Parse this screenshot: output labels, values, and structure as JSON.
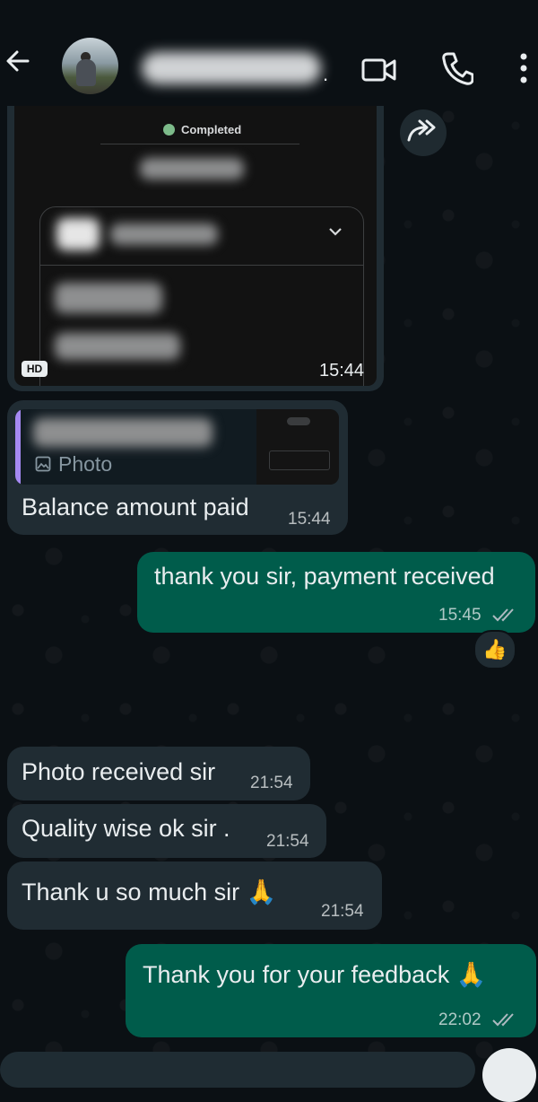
{
  "status_bar": {
    "left_text": "",
    "right_text": ""
  },
  "header": {
    "contact_name": "",
    "name_suffix": ".",
    "icons": [
      "back-arrow-icon",
      "video-call-icon",
      "voice-call-icon",
      "more-options-icon"
    ]
  },
  "avatar_caption": "",
  "image_message": {
    "status_label": "Completed",
    "hd_label": "HD",
    "time": "15:44",
    "icons": [
      "check-circle-icon",
      "chevron-down-icon",
      "forward-icon"
    ]
  },
  "reply_message": {
    "quote_type_label": "Photo",
    "text": "Balance amount paid",
    "time": "15:44"
  },
  "messages": [
    {
      "direction": "out",
      "text": "thank you sir, payment received",
      "time": "15:45",
      "reaction": "👍"
    },
    {
      "direction": "in",
      "text": "Photo received sir",
      "time": "21:54"
    },
    {
      "direction": "in",
      "text": "Quality wise ok sir .",
      "time": "21:54"
    },
    {
      "direction": "in",
      "text": "Thank u so much sir 🙏",
      "time": "21:54"
    },
    {
      "direction": "out",
      "text": "Thank you for your feedback 🙏",
      "time": "22:02"
    }
  ],
  "colors": {
    "background": "#0b1014",
    "incoming_bubble": "#202c33",
    "outgoing_bubble": "#005c4b",
    "text": "#e9edef",
    "read_ticks": "#aebac1",
    "reply_accent": "#a589f2"
  }
}
